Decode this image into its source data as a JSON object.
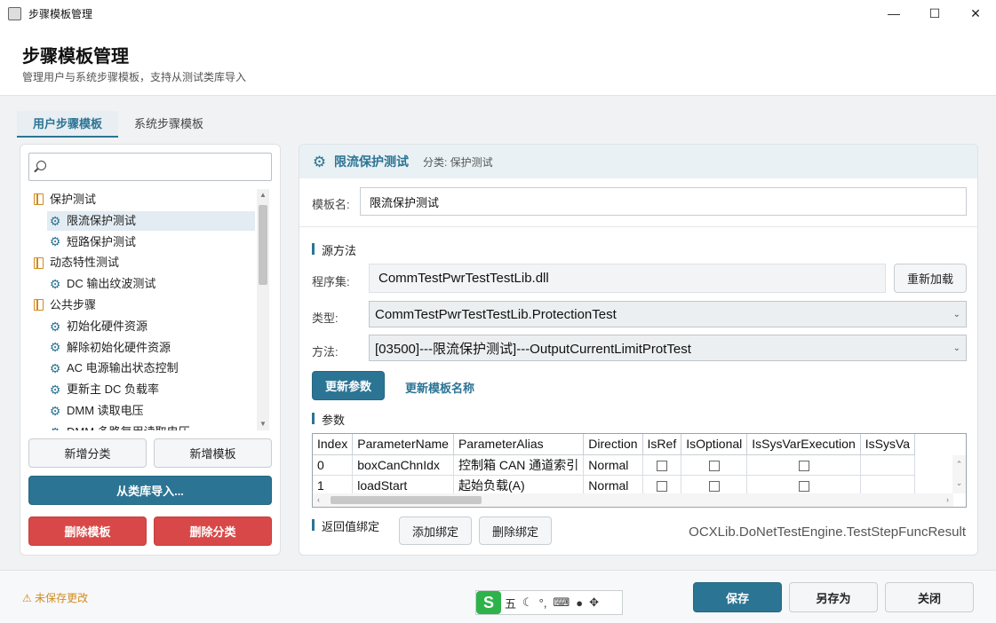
{
  "window": {
    "title": "步骤模板管理",
    "controls": [
      "—",
      "☐",
      "✕"
    ]
  },
  "header": {
    "title": "步骤模板管理",
    "subtitle": "管理用户与系统步骤模板，支持从测试类库导入"
  },
  "tabs": [
    {
      "label": "用户步骤模板",
      "active": true
    },
    {
      "label": "系统步骤模板",
      "active": false
    }
  ],
  "search": {
    "placeholder": "",
    "value": ""
  },
  "tree": [
    {
      "type": "category",
      "label": "保护测试"
    },
    {
      "type": "template",
      "label": "限流保护测试",
      "selected": true
    },
    {
      "type": "template",
      "label": "短路保护测试"
    },
    {
      "type": "category",
      "label": "动态特性测试"
    },
    {
      "type": "template",
      "label": "DC 输出纹波测试"
    },
    {
      "type": "category",
      "label": "公共步骤"
    },
    {
      "type": "template",
      "label": "初始化硬件资源"
    },
    {
      "type": "template",
      "label": "解除初始化硬件资源"
    },
    {
      "type": "template",
      "label": "AC 电源输出状态控制"
    },
    {
      "type": "template",
      "label": "更新主 DC 负载率"
    },
    {
      "type": "template",
      "label": "DMM 读取电压"
    },
    {
      "type": "template",
      "label": "DMM 多路复用读取电压"
    }
  ],
  "left_buttons": {
    "add_category": "新增分类",
    "add_template": "新增模板",
    "import_from_lib": "从类库导入...",
    "delete_template": "删除模板",
    "delete_category": "删除分类"
  },
  "detail": {
    "title": "限流保护测试",
    "category_text": "分类: 保护测试",
    "template_name_label": "模板名:",
    "template_name_value": "限流保护测试",
    "source_section": "源方法",
    "assembly_label": "程序集:",
    "assembly_value": "CommTestPwrTestTestLib.dll",
    "reload_button": "重新加载",
    "type_label": "类型:",
    "type_value": "CommTestPwrTestTestLib.ProtectionTest",
    "method_label": "方法:",
    "method_value": "[03500]---限流保护测试]---OutputCurrentLimitProtTest",
    "update_params_button": "更新参数",
    "update_name_link": "更新模板名称",
    "params_section": "参数",
    "params_columns": [
      "Index",
      "ParameterName",
      "ParameterAlias",
      "Direction",
      "IsRef",
      "IsOptional",
      "IsSysVarExecution",
      "IsSysVa"
    ],
    "params_rows": [
      {
        "index": "0",
        "name": "boxCanChnIdx",
        "alias": "控制箱 CAN 通道索引",
        "direction": "Normal",
        "isref": false,
        "isoptional": false,
        "issysvarexec": false
      },
      {
        "index": "1",
        "name": "loadStart",
        "alias": "起始负载(A)",
        "direction": "Normal",
        "isref": false,
        "isoptional": false,
        "issysvarexec": false
      }
    ],
    "return_section": "返回值绑定",
    "add_binding_button": "添加绑定",
    "delete_binding_button": "删除绑定",
    "return_type": "OCXLib.DoNetTestEngine.TestStepFuncResult"
  },
  "footer": {
    "unsaved_text": "未保存更改",
    "save_button": "保存",
    "save_as_button": "另存为",
    "close_button": "关闭",
    "ime": {
      "logo": "S",
      "mode": "五"
    }
  },
  "colors": {
    "primary": "#2c7494",
    "danger": "#d94848",
    "warning": "#d28a1f"
  }
}
